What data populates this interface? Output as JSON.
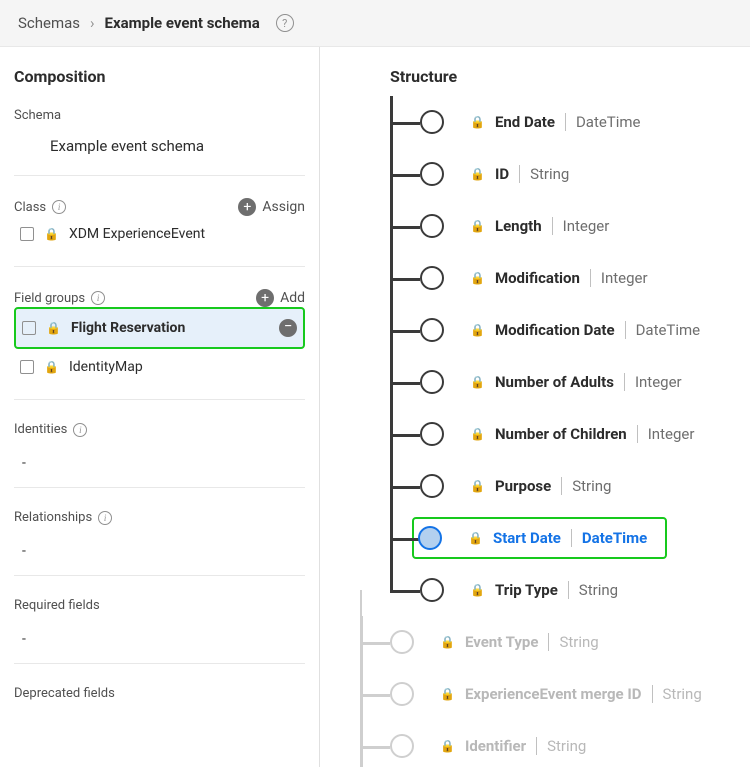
{
  "breadcrumb": {
    "root": "Schemas",
    "current": "Example event schema"
  },
  "composition": {
    "title": "Composition",
    "schema_label": "Schema",
    "schema_name": "Example event schema",
    "class_label": "Class",
    "assign_label": "Assign",
    "class_items": [
      {
        "label": "XDM ExperienceEvent"
      }
    ],
    "field_groups_label": "Field groups",
    "add_label": "Add",
    "field_group_items": [
      {
        "label": "Flight Reservation",
        "bold": true,
        "highlighted": true,
        "removable": true
      },
      {
        "label": "IdentityMap"
      }
    ],
    "identities_label": "Identities",
    "identities_value": "-",
    "relationships_label": "Relationships",
    "relationships_value": "-",
    "required_fields_label": "Required fields",
    "required_fields_value": "-",
    "deprecated_fields_label": "Deprecated fields"
  },
  "structure": {
    "title": "Structure",
    "nodes": [
      {
        "name": "End Date",
        "type": "DateTime"
      },
      {
        "name": "ID",
        "type": "String"
      },
      {
        "name": "Length",
        "type": "Integer"
      },
      {
        "name": "Modification",
        "type": "Integer"
      },
      {
        "name": "Modification Date",
        "type": "DateTime"
      },
      {
        "name": "Number of Adults",
        "type": "Integer"
      },
      {
        "name": "Number of Children",
        "type": "Integer"
      },
      {
        "name": "Purpose",
        "type": "String"
      },
      {
        "name": "Start Date",
        "type": "DateTime",
        "selected": true
      },
      {
        "name": "Trip Type",
        "type": "String",
        "last": true
      }
    ],
    "dim_nodes": [
      {
        "name": "Event Type",
        "type": "String"
      },
      {
        "name": "ExperienceEvent merge ID",
        "type": "String"
      },
      {
        "name": "Identifier",
        "type": "String"
      }
    ]
  }
}
